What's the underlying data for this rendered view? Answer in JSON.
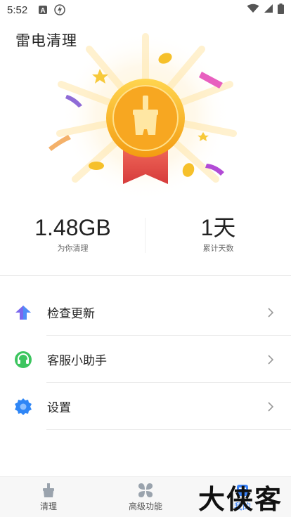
{
  "status_bar": {
    "time": "5:52"
  },
  "header": {
    "title": "雷电清理"
  },
  "stats": [
    {
      "value": "1.48GB",
      "label": "为你清理"
    },
    {
      "value": "1天",
      "label": "累计天数"
    }
  ],
  "menu": [
    {
      "label": "检查更新",
      "icon": "upgrade-arrow-icon"
    },
    {
      "label": "客服小助手",
      "icon": "headset-icon"
    },
    {
      "label": "设置",
      "icon": "gear-icon"
    }
  ],
  "bottom_nav": [
    {
      "label": "清理",
      "icon": "broom-icon"
    },
    {
      "label": "高级功能",
      "icon": "clover-icon"
    },
    {
      "label": "我的",
      "icon": "profile-icon",
      "active": true
    }
  ],
  "watermark": "大侠客",
  "colors": {
    "accent": "#3b82f6",
    "medal_gold": "#f6b52a",
    "ribbon_red": "#e94e4e"
  }
}
